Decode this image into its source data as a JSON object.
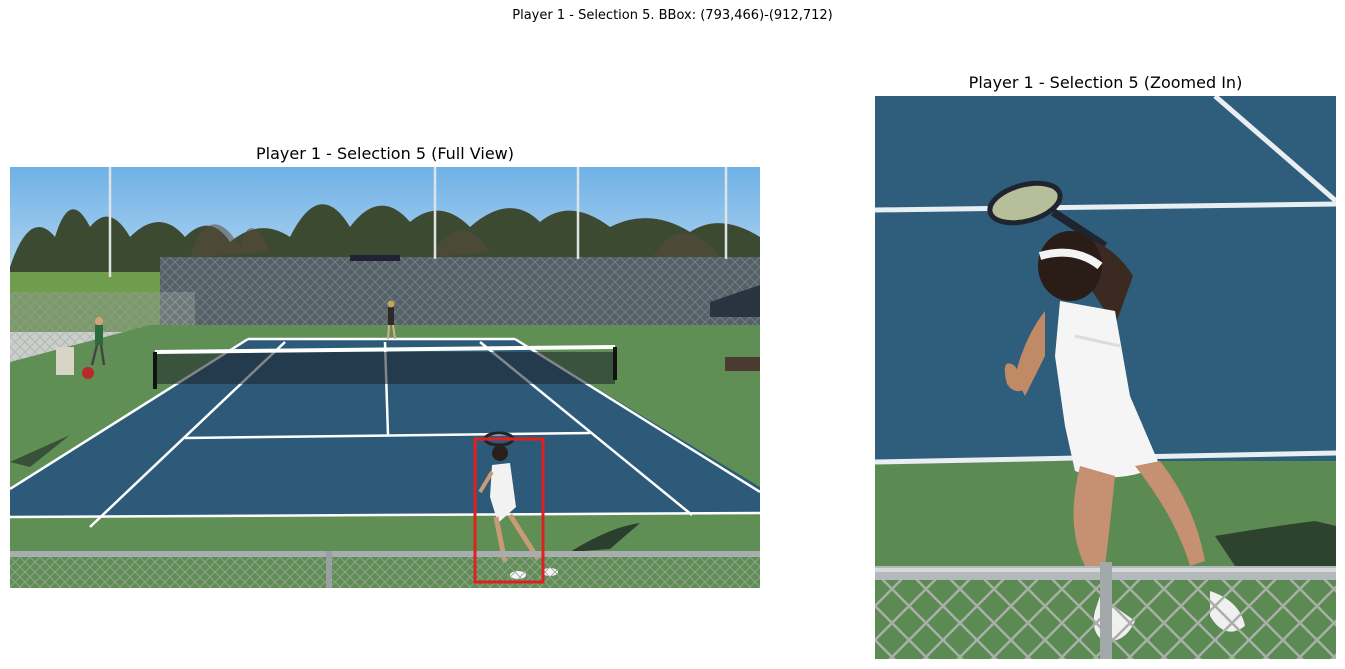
{
  "figure": {
    "suptitle": "Player 1 - Selection 5. BBox: (793,466)-(912,712)"
  },
  "panels": {
    "left": {
      "title": "Player 1 - Selection 5 (Full View)"
    },
    "right": {
      "title": "Player 1 - Selection 5 (Zoomed In)"
    }
  },
  "annotation": {
    "bbox_color": "#e02020"
  },
  "colors": {
    "sky": "#7bb8e8",
    "court_blue": "#2d5a78",
    "court_green": "#5f8f55",
    "lines": "#ffffff"
  }
}
